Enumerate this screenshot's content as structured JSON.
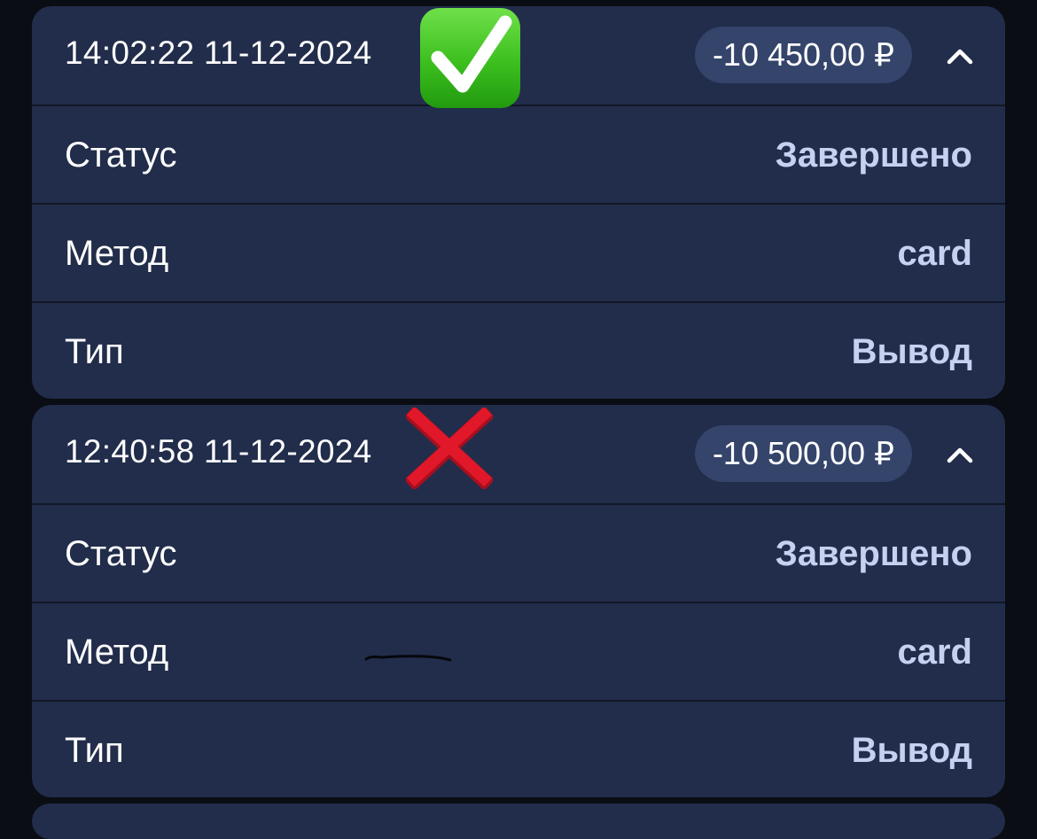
{
  "transactions": [
    {
      "datetime": "14:02:22 11-12-2024",
      "amount": "-10 450,00 ₽",
      "rows": [
        {
          "label": "Статус",
          "value": "Завершено"
        },
        {
          "label": "Метод",
          "value": "card"
        },
        {
          "label": "Тип",
          "value": "Вывод"
        }
      ],
      "expanded": true
    },
    {
      "datetime": "12:40:58 11-12-2024",
      "amount": "-10 500,00 ₽",
      "rows": [
        {
          "label": "Статус",
          "value": "Завершено"
        },
        {
          "label": "Метод",
          "value": "card"
        },
        {
          "label": "Тип",
          "value": "Вывод"
        }
      ],
      "expanded": true
    }
  ],
  "annotations": {
    "first": "check-mark-emoji",
    "second": "cross-mark-emoji"
  },
  "colors": {
    "background": "#0b0d14",
    "card": "#222d4b",
    "pill": "#34446a",
    "value_text": "#c6d1f2",
    "check_green": "#3cbf1e",
    "cross_red": "#e0182a"
  }
}
